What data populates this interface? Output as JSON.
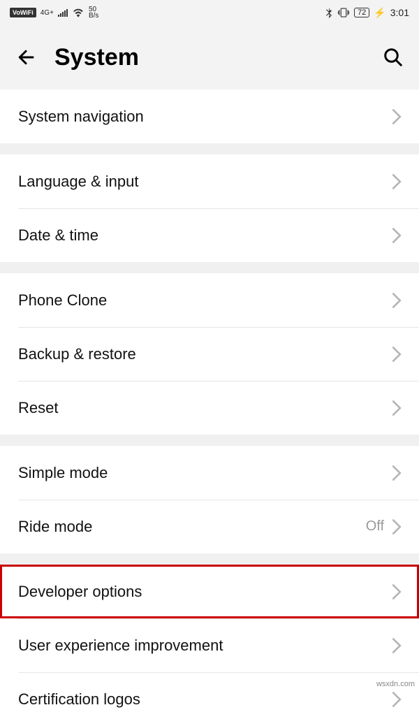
{
  "statusbar": {
    "vowifi": "VoWiFi",
    "net_up": "4G+",
    "net_rate_top": "50",
    "net_rate_bot": "B/s",
    "battery": "72",
    "time": "3:01"
  },
  "header": {
    "title": "System"
  },
  "groups": [
    {
      "rows": [
        {
          "label": "System navigation",
          "value": ""
        }
      ]
    },
    {
      "rows": [
        {
          "label": "Language & input",
          "value": ""
        },
        {
          "label": "Date & time",
          "value": ""
        }
      ]
    },
    {
      "rows": [
        {
          "label": "Phone Clone",
          "value": ""
        },
        {
          "label": "Backup & restore",
          "value": ""
        },
        {
          "label": "Reset",
          "value": ""
        }
      ]
    },
    {
      "rows": [
        {
          "label": "Simple mode",
          "value": ""
        },
        {
          "label": "Ride mode",
          "value": "Off"
        }
      ]
    },
    {
      "rows": [
        {
          "label": "Developer options",
          "value": "",
          "highlight": true
        },
        {
          "label": "User experience improvement",
          "value": ""
        },
        {
          "label": "Certification logos",
          "value": ""
        }
      ]
    }
  ],
  "watermark": "wsxdn.com"
}
